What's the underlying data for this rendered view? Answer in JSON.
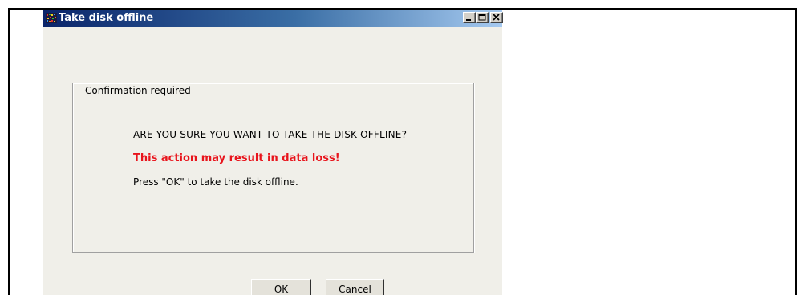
{
  "window": {
    "title": "Take disk offline",
    "app_icon": "app-icon",
    "controls": {
      "minimize_icon": "minimize-icon",
      "maximize_icon": "maximize-icon",
      "close_icon": "close-icon"
    }
  },
  "group": {
    "legend": "Confirmation required",
    "question": "ARE YOU SURE YOU WANT TO TAKE THE DISK OFFLINE?",
    "warning": "This action may result in data loss!",
    "instruction": "Press \"OK\" to take the disk offline."
  },
  "buttons": {
    "ok_label": "OK",
    "cancel_label": "Cancel"
  },
  "colors": {
    "titlebar_start": "#0a246a",
    "titlebar_end": "#a6caf0",
    "warning_text": "#e8141c",
    "dialog_bg": "#f0efe9"
  }
}
